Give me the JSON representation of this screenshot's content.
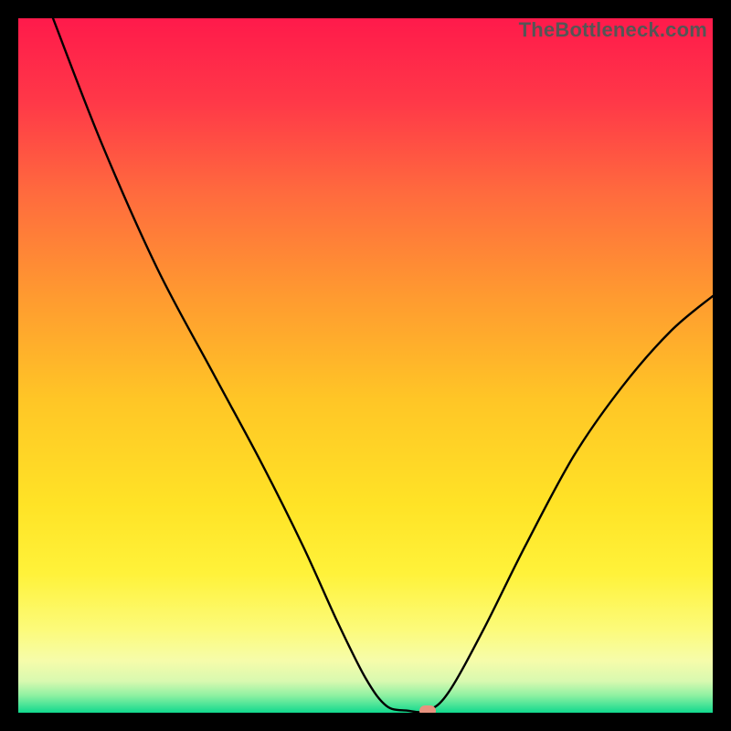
{
  "attribution": "TheBottleneck.com",
  "gradient_stops": [
    {
      "offset": 0.0,
      "color": "#ff1a4b"
    },
    {
      "offset": 0.12,
      "color": "#ff3848"
    },
    {
      "offset": 0.25,
      "color": "#ff6a3e"
    },
    {
      "offset": 0.4,
      "color": "#ff9a30"
    },
    {
      "offset": 0.55,
      "color": "#ffc626"
    },
    {
      "offset": 0.7,
      "color": "#ffe326"
    },
    {
      "offset": 0.8,
      "color": "#fff23a"
    },
    {
      "offset": 0.88,
      "color": "#fcfb7a"
    },
    {
      "offset": 0.925,
      "color": "#f6fcaa"
    },
    {
      "offset": 0.955,
      "color": "#d8f9b0"
    },
    {
      "offset": 0.975,
      "color": "#8ff1a2"
    },
    {
      "offset": 1.0,
      "color": "#11d98e"
    }
  ],
  "chart_data": {
    "type": "line",
    "title": "",
    "xlabel": "",
    "ylabel": "",
    "x_range": [
      0,
      100
    ],
    "y_range": [
      0,
      100
    ],
    "series": [
      {
        "name": "bottleneck-curve",
        "color": "#000000",
        "points": [
          {
            "x": 5,
            "y": 100
          },
          {
            "x": 12,
            "y": 82
          },
          {
            "x": 20,
            "y": 64
          },
          {
            "x": 28,
            "y": 49
          },
          {
            "x": 35,
            "y": 36
          },
          {
            "x": 41,
            "y": 24
          },
          {
            "x": 46,
            "y": 13
          },
          {
            "x": 50,
            "y": 5
          },
          {
            "x": 53,
            "y": 1
          },
          {
            "x": 56,
            "y": 0.3
          },
          {
            "x": 59,
            "y": 0.3
          },
          {
            "x": 62,
            "y": 3
          },
          {
            "x": 67,
            "y": 12
          },
          {
            "x": 73,
            "y": 24
          },
          {
            "x": 80,
            "y": 37
          },
          {
            "x": 87,
            "y": 47
          },
          {
            "x": 94,
            "y": 55
          },
          {
            "x": 100,
            "y": 60
          }
        ]
      }
    ],
    "marker": {
      "x": 59,
      "y": 0.3,
      "color": "#e8927f"
    }
  }
}
